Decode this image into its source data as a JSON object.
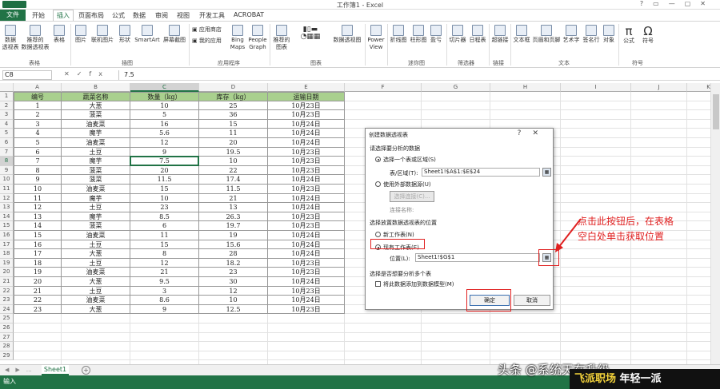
{
  "window": {
    "title": "工作簿1 - Excel",
    "qat_icon": "save-icon",
    "controls": [
      "?",
      "▭",
      "—",
      "▢",
      "✕"
    ]
  },
  "tabs": [
    {
      "label": "文件",
      "type": "file"
    },
    {
      "label": "开始"
    },
    {
      "label": "插入",
      "active": true
    },
    {
      "label": "页面布局"
    },
    {
      "label": "公式"
    },
    {
      "label": "数据"
    },
    {
      "label": "审阅"
    },
    {
      "label": "视图"
    },
    {
      "label": "开发工具"
    },
    {
      "label": "ACROBAT"
    }
  ],
  "ribbon": {
    "buttons": [
      {
        "label": "数据\n透视表",
        "icon": "pivot-table-icon"
      },
      {
        "label": "推荐的\n数据透视表",
        "icon": "recommended-pivot-icon"
      },
      {
        "label": "表格",
        "icon": "table-icon"
      },
      {
        "label": "图片",
        "icon": "picture-icon"
      },
      {
        "label": "联机图片",
        "icon": "online-picture-icon"
      },
      {
        "label": "形状",
        "icon": "shapes-icon"
      },
      {
        "label": "SmartArt",
        "icon": "smartart-icon"
      },
      {
        "label": "屏幕截图",
        "icon": "screenshot-icon"
      },
      {
        "label": "Bing\nMaps",
        "icon": "bing-maps-icon"
      },
      {
        "label": "People\nGraph",
        "icon": "people-graph-icon"
      },
      {
        "label": "推荐的\n图表",
        "icon": "recommended-chart-icon"
      },
      {
        "label": "数据透视图",
        "icon": "pivot-chart-icon"
      },
      {
        "label": "Power\nView",
        "icon": "power-view-icon"
      },
      {
        "label": "折线图",
        "icon": "line-sparkline-icon"
      },
      {
        "label": "柱形图",
        "icon": "column-sparkline-icon"
      },
      {
        "label": "盈亏",
        "icon": "winloss-sparkline-icon"
      },
      {
        "label": "切片器",
        "icon": "slicer-icon"
      },
      {
        "label": "日程表",
        "icon": "timeline-icon"
      },
      {
        "label": "超链接",
        "icon": "hyperlink-icon"
      },
      {
        "label": "文本框",
        "icon": "textbox-icon"
      },
      {
        "label": "页眉和页脚",
        "icon": "header-footer-icon"
      },
      {
        "label": "艺术字",
        "icon": "wordart-icon"
      },
      {
        "label": "签名行",
        "icon": "signature-icon"
      },
      {
        "label": "对象",
        "icon": "object-icon"
      },
      {
        "label": "公式",
        "icon": "equation-icon"
      },
      {
        "label": "符号",
        "icon": "symbol-icon"
      }
    ],
    "small_buttons": [
      {
        "label": "应用商店",
        "icon": "store-icon"
      },
      {
        "label": "我的应用",
        "icon": "my-apps-icon"
      }
    ],
    "groups": [
      "表格",
      "插图",
      "应用程序",
      "图表",
      "迷你图",
      "筛选器",
      "链接",
      "文本",
      "符号"
    ]
  },
  "formula_bar": {
    "name_box": "C8",
    "icons": [
      "✕",
      "✓",
      "fx"
    ],
    "value": "7.5"
  },
  "columns": [
    "A",
    "B",
    "C",
    "D",
    "E",
    "F",
    "G",
    "H",
    "I",
    "J",
    "K"
  ],
  "selected_column": "C",
  "selected_row": 8,
  "row_numbers": [
    "1",
    "2",
    "3",
    "4",
    "5",
    "6",
    "7",
    "8",
    "9",
    "10",
    "11",
    "12",
    "13",
    "14",
    "15",
    "16",
    "17",
    "18",
    "19",
    "20",
    "21",
    "22",
    "23",
    "24",
    "25",
    "26",
    "27",
    "28",
    "29"
  ],
  "table": {
    "headers": [
      "编号",
      "蔬菜名称",
      "数量（kg）",
      "库存（kg）",
      "运输日期"
    ],
    "header_color": "#a9d08e",
    "rows": [
      [
        "1",
        "大葱",
        "10",
        "25",
        "10月23日"
      ],
      [
        "2",
        "菠菜",
        "5",
        "36",
        "10月23日"
      ],
      [
        "3",
        "油麦菜",
        "16",
        "15",
        "10月24日"
      ],
      [
        "4",
        "魔芋",
        "5.6",
        "11",
        "10月24日"
      ],
      [
        "5",
        "油麦菜",
        "12",
        "20",
        "10月24日"
      ],
      [
        "6",
        "土豆",
        "9",
        "19.5",
        "10月23日"
      ],
      [
        "7",
        "魔芋",
        "7.5",
        "10",
        "10月23日"
      ],
      [
        "8",
        "菠菜",
        "20",
        "22",
        "10月23日"
      ],
      [
        "9",
        "菠菜",
        "11.5",
        "17.4",
        "10月24日"
      ],
      [
        "10",
        "油麦菜",
        "15",
        "11.5",
        "10月23日"
      ],
      [
        "11",
        "魔芋",
        "10",
        "21",
        "10月24日"
      ],
      [
        "12",
        "土豆",
        "23",
        "13",
        "10月24日"
      ],
      [
        "13",
        "魔芋",
        "8.5",
        "26.3",
        "10月23日"
      ],
      [
        "14",
        "菠菜",
        "6",
        "19.7",
        "10月23日"
      ],
      [
        "15",
        "油麦菜",
        "11",
        "19",
        "10月24日"
      ],
      [
        "16",
        "土豆",
        "15",
        "15.6",
        "10月24日"
      ],
      [
        "17",
        "大葱",
        "8",
        "28",
        "10月24日"
      ],
      [
        "18",
        "土豆",
        "12",
        "18.2",
        "10月23日"
      ],
      [
        "19",
        "油麦菜",
        "21",
        "23",
        "10月23日"
      ],
      [
        "20",
        "大葱",
        "9.5",
        "30",
        "10月24日"
      ],
      [
        "21",
        "土豆",
        "3",
        "12",
        "10月23日"
      ],
      [
        "22",
        "油麦菜",
        "8.6",
        "10",
        "10月24日"
      ],
      [
        "23",
        "大葱",
        "9",
        "12.5",
        "10月23日"
      ]
    ]
  },
  "dialog": {
    "title": "创建数据透视表",
    "title_buttons": [
      "?",
      "✕"
    ],
    "section1": "请选择要分析的数据",
    "option_table": "选择一个表或区域(S)",
    "range_label": "表/区域(T):",
    "range_value": "Sheet1!$A$1:$E$24",
    "option_external": "使用外部数据源(U)",
    "choose_connection": "选择连接(C)...",
    "connection_name": "连接名称:",
    "section2": "选择放置数据透视表的位置",
    "option_new": "新工作表(N)",
    "option_existing": "现有工作表(E)",
    "location_label": "位置(L):",
    "location_value": "Sheet1!$G$1",
    "section3": "选择是否想要分析多个表",
    "checkbox_label": "将此数据添加到数据模型(M)",
    "ok": "确定",
    "cancel": "取消"
  },
  "annotation": {
    "line1": "点击此按钮后，在表格",
    "line2": "空白处单击获取位置",
    "color": "#e02020"
  },
  "sheet_tab": "Sheet1",
  "add_sheet": "+",
  "status": "输入",
  "watermark": "头条 @系统天在升级",
  "brand": {
    "part1": "飞派职场",
    "part2": "年轻一派"
  },
  "colors": {
    "accent": "#217346",
    "annotation": "#e02020"
  }
}
